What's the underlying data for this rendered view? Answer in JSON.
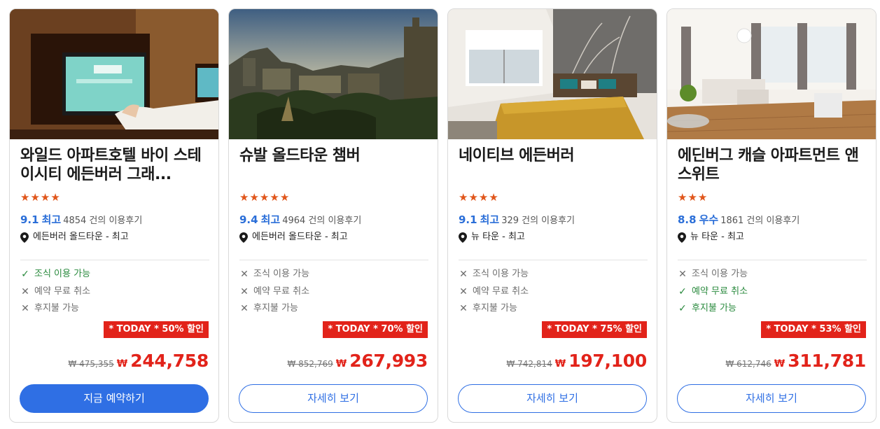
{
  "colors": {
    "accent_blue": "#2f6fe4",
    "rating_blue": "#2a6ed8",
    "sale_red": "#e2231a",
    "star_orange": "#e0561b",
    "available_green": "#2a8a3e",
    "unavailable_gray": "#6d6d6d"
  },
  "icons": {
    "star": "★",
    "check": "✓",
    "cross": "✕",
    "pin": "location-pin-icon"
  },
  "cards": [
    {
      "name": "와일드 아파트호텔 바이 스테이시티 에든버러 그래...",
      "star_count": 4,
      "score": "9.1",
      "grade": "최고",
      "reviews": "4854 건의 이용후기",
      "location": "에든버러 올드타운 - 최고",
      "amenities": [
        {
          "label": "조식 이용 가능",
          "available": true
        },
        {
          "label": "예약 무료 취소",
          "available": false
        },
        {
          "label": "후지불 가능",
          "available": false
        }
      ],
      "deal": "* TODAY * 50% 할인",
      "old_price": "₩ 475,355",
      "currency": "₩",
      "price": "244,758",
      "button": "지금 예약하기",
      "button_style": "primary"
    },
    {
      "name": "슈발 올드타운 챔버",
      "star_count": 5,
      "score": "9.4",
      "grade": "최고",
      "reviews": "4964 건의 이용후기",
      "location": "에든버러 올드타운 - 최고",
      "amenities": [
        {
          "label": "조식 이용 가능",
          "available": false
        },
        {
          "label": "예약 무료 취소",
          "available": false
        },
        {
          "label": "후지불 가능",
          "available": false
        }
      ],
      "deal": "* TODAY * 70% 할인",
      "old_price": "₩ 852,769",
      "currency": "₩",
      "price": "267,993",
      "button": "자세히 보기",
      "button_style": "secondary"
    },
    {
      "name": "네이티브 에든버러",
      "star_count": 4,
      "score": "9.1",
      "grade": "최고",
      "reviews": "329 건의 이용후기",
      "location": "뉴 타운 - 최고",
      "amenities": [
        {
          "label": "조식 이용 가능",
          "available": false
        },
        {
          "label": "예약 무료 취소",
          "available": false
        },
        {
          "label": "후지불 가능",
          "available": false
        }
      ],
      "deal": "* TODAY * 75% 할인",
      "old_price": "₩ 742,814",
      "currency": "₩",
      "price": "197,100",
      "button": "자세히 보기",
      "button_style": "secondary"
    },
    {
      "name": "에딘버그 캐슬 아파트먼트 앤 스위트",
      "star_count": 3,
      "score": "8.8",
      "grade": "우수",
      "reviews": "1861 건의 이용후기",
      "location": "뉴 타운 - 최고",
      "amenities": [
        {
          "label": "조식 이용 가능",
          "available": false
        },
        {
          "label": "예약 무료 취소",
          "available": true
        },
        {
          "label": "후지불 가능",
          "available": true
        }
      ],
      "deal": "* TODAY * 53% 할인",
      "old_price": "₩ 612,746",
      "currency": "₩",
      "price": "311,781",
      "button": "자세히 보기",
      "button_style": "secondary"
    }
  ]
}
